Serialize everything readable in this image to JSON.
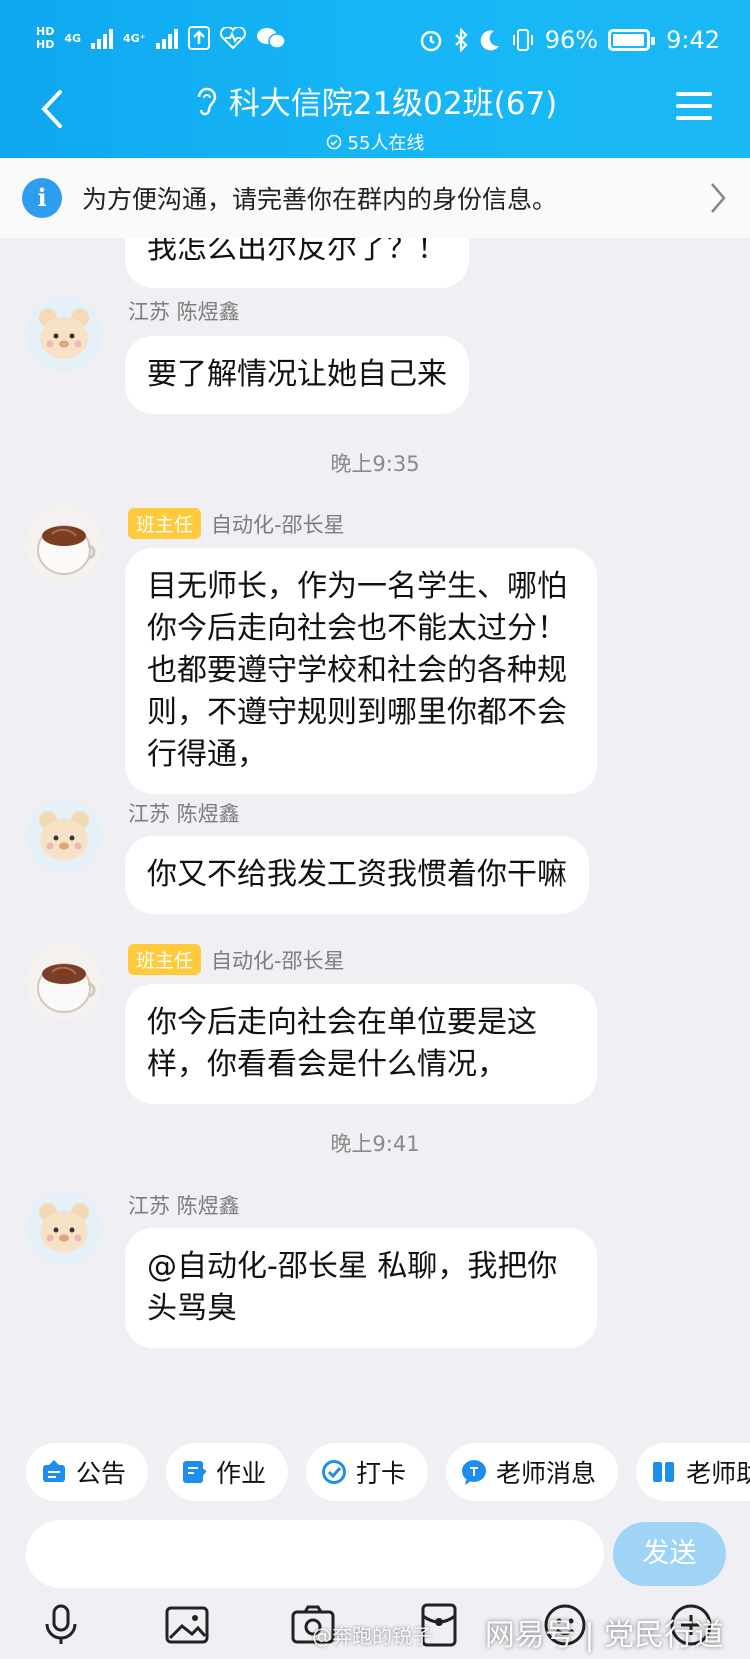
{
  "status_bar": {
    "battery": "96%",
    "time": "9:42",
    "net1": "HD",
    "net2": "HD",
    "gen1": "4G",
    "gen2": "4G⁺"
  },
  "header": {
    "title": "科大信院21级02班(67)",
    "online": "55人在线"
  },
  "notice": {
    "text": "为方便沟通，请完善你在群内的身份信息。"
  },
  "messages": [
    {
      "type": "partial",
      "text": "我怎么出尔反尔了？！"
    },
    {
      "type": "msg",
      "avatar": "bear",
      "badge": "",
      "sender": "江苏  陈煜鑫",
      "text": "要了解情况让她自己来"
    },
    {
      "type": "time",
      "text": "晚上9:35"
    },
    {
      "type": "msg",
      "avatar": "cup",
      "badge": "班主任",
      "sender": "自动化-邵长星",
      "text": "目无师长，作为一名学生、哪怕你今后走向社会也不能太过分！也都要遵守学校和社会的各种规则，不遵守规则到哪里你都不会行得通，"
    },
    {
      "type": "msg",
      "avatar": "bear",
      "badge": "",
      "sender": "江苏  陈煜鑫",
      "text": "你又不给我发工资我惯着你干嘛"
    },
    {
      "type": "msg",
      "avatar": "cup",
      "badge": "班主任",
      "sender": "自动化-邵长星",
      "text": "你今后走向社会在单位要是这样，你看看会是什么情况，"
    },
    {
      "type": "time",
      "text": "晚上9:41"
    },
    {
      "type": "msg",
      "avatar": "bear",
      "badge": "",
      "sender": "江苏  陈煜鑫",
      "text": "@自动化-邵长星 私聊，我把你头骂臭"
    }
  ],
  "quick_actions": [
    {
      "label": "公告",
      "icon": "announcement-icon",
      "color": "#1d8ef0"
    },
    {
      "label": "作业",
      "icon": "homework-icon",
      "color": "#1d8ef0"
    },
    {
      "label": "打卡",
      "icon": "checkin-icon",
      "color": "#1d8ef0"
    },
    {
      "label": "老师消息",
      "icon": "teacher-message-icon",
      "color": "#1d8ef0"
    },
    {
      "label": "老师助",
      "icon": "teacher-assistant-icon",
      "color": "#1d8ef0"
    }
  ],
  "input": {
    "send_label": "发送"
  },
  "toolbar": [
    "voice-icon",
    "image-icon",
    "camera-icon",
    "red-packet-icon",
    "emoji-icon",
    "plus-icon"
  ],
  "watermarks": {
    "weibo": "@奔跑的锐子",
    "netease": "网易号 | 党民行道"
  },
  "colors": {
    "header": "#16b6f6",
    "badge": "#ffcb3d",
    "send": "#9fd4f7",
    "background": "#efeff4"
  }
}
